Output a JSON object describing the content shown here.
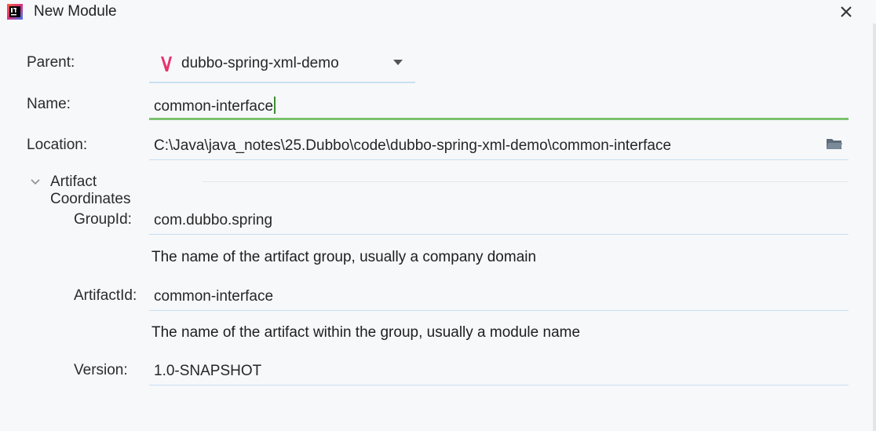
{
  "window": {
    "title": "New Module",
    "icon": "intellij-idea-icon",
    "close_icon": "close-icon"
  },
  "form": {
    "parent": {
      "label": "Parent:",
      "value": "dubbo-spring-xml-demo",
      "icon": "maven-project-icon"
    },
    "name": {
      "label": "Name:",
      "value": "common-interface"
    },
    "location": {
      "label": "Location:",
      "value": "C:\\Java\\java_notes\\25.Dubbo\\code\\dubbo-spring-xml-demo\\common-interface",
      "icon": "folder-icon"
    }
  },
  "artifact": {
    "section_title": "Artifact Coordinates",
    "group_id": {
      "label": "GroupId:",
      "value": "com.dubbo.spring",
      "hint": "The name of the artifact group, usually a company domain"
    },
    "artifact_id": {
      "label": "ArtifactId:",
      "value": "common-interface",
      "hint": "The name of the artifact within the group, usually a module name"
    },
    "version": {
      "label": "Version:",
      "value": "1.0-SNAPSHOT"
    }
  },
  "colors": {
    "background": "#f7f8fa",
    "focus_underline": "#7cc36f",
    "field_underline": "#c7dff2",
    "parent_icon": "#e8336d"
  }
}
